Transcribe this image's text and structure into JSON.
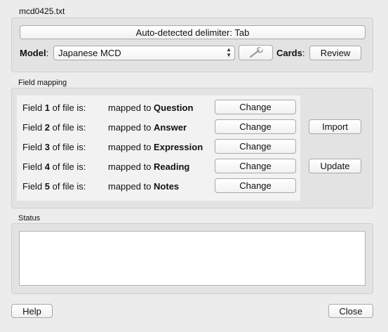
{
  "window": {
    "title": "mcd0425.txt"
  },
  "file_group": {
    "delimiter_button": "Auto-detected delimiter: Tab",
    "model_label": "Model",
    "model_value": "Japanese MCD",
    "cards_label": "Cards",
    "review_button": "Review"
  },
  "field_mapping": {
    "title": "Field mapping",
    "rows": [
      {
        "prefix": "Field ",
        "num": "1",
        "suffix": " of file is:",
        "mapped_prefix": "mapped to ",
        "target": "Question",
        "change": "Change"
      },
      {
        "prefix": "Field ",
        "num": "2",
        "suffix": " of file is:",
        "mapped_prefix": "mapped to ",
        "target": "Answer",
        "change": "Change"
      },
      {
        "prefix": "Field ",
        "num": "3",
        "suffix": " of file is:",
        "mapped_prefix": "mapped to ",
        "target": "Expression",
        "change": "Change"
      },
      {
        "prefix": "Field ",
        "num": "4",
        "suffix": " of file is:",
        "mapped_prefix": "mapped to ",
        "target": "Reading",
        "change": "Change"
      },
      {
        "prefix": "Field ",
        "num": "5",
        "suffix": " of file is:",
        "mapped_prefix": "mapped to ",
        "target": "Notes",
        "change": "Change"
      }
    ],
    "import_button": "Import",
    "update_button": "Update"
  },
  "status": {
    "title": "Status",
    "text": ""
  },
  "footer": {
    "help_button": "Help",
    "close_button": "Close"
  },
  "icons": {
    "model_tool": "wrench-icon",
    "select_arrows": "updown-arrows-icon"
  }
}
